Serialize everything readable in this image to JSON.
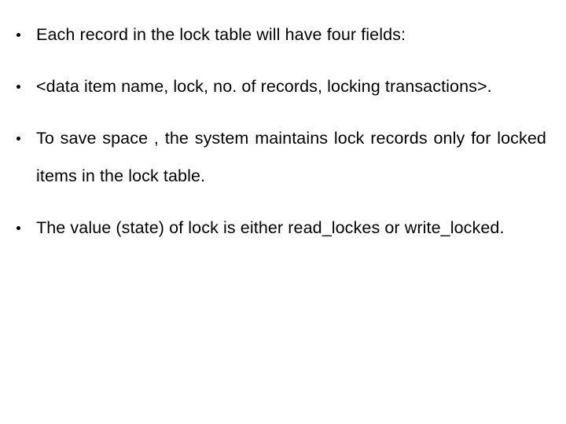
{
  "slide": {
    "background_color": "#ffffff",
    "text_color": "#000000",
    "bullet_glyph": "•",
    "bullets": [
      {
        "id": "lock-record-fields",
        "text": "Each record in the lock table will have four fields:",
        "wraps": false
      },
      {
        "id": "lock-record-format",
        "text": "<data item name, lock, no. of records, locking transactions>.",
        "wraps": true
      },
      {
        "id": "space-saving",
        "text": "To save space , the system maintains lock records only for locked items in the lock table.",
        "wraps": true
      },
      {
        "id": "lock-states",
        "text": "The value (state) of lock is either read_lockes or write_locked.",
        "wraps": true
      }
    ]
  }
}
